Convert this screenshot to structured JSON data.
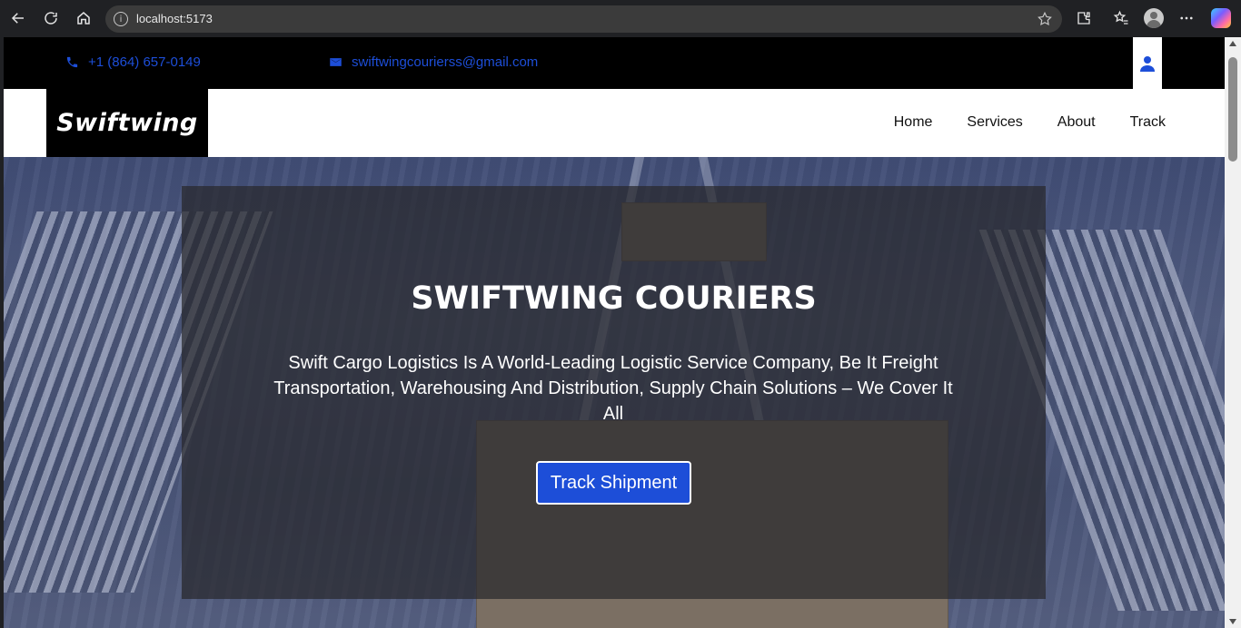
{
  "browser": {
    "url": "localhost:5173"
  },
  "topbar": {
    "phone": "+1 (864) 657-0149",
    "email": "swiftwingcourierss@gmail.com"
  },
  "navbar": {
    "logo": "Swiftwing",
    "links": [
      "Home",
      "Services",
      "About",
      "Track"
    ]
  },
  "hero": {
    "title": "SWIFTWING COURIERS",
    "text": "Swift Cargo Logistics Is A World-Leading Logistic Service Company, Be It Freight Transportation, Warehousing And Distribution, Supply Chain Solutions – We Cover It All",
    "button": "Track Shipment"
  },
  "colors": {
    "accent": "#1d4ed8",
    "topbar_bg": "#000000",
    "overlay": "#28282d"
  }
}
